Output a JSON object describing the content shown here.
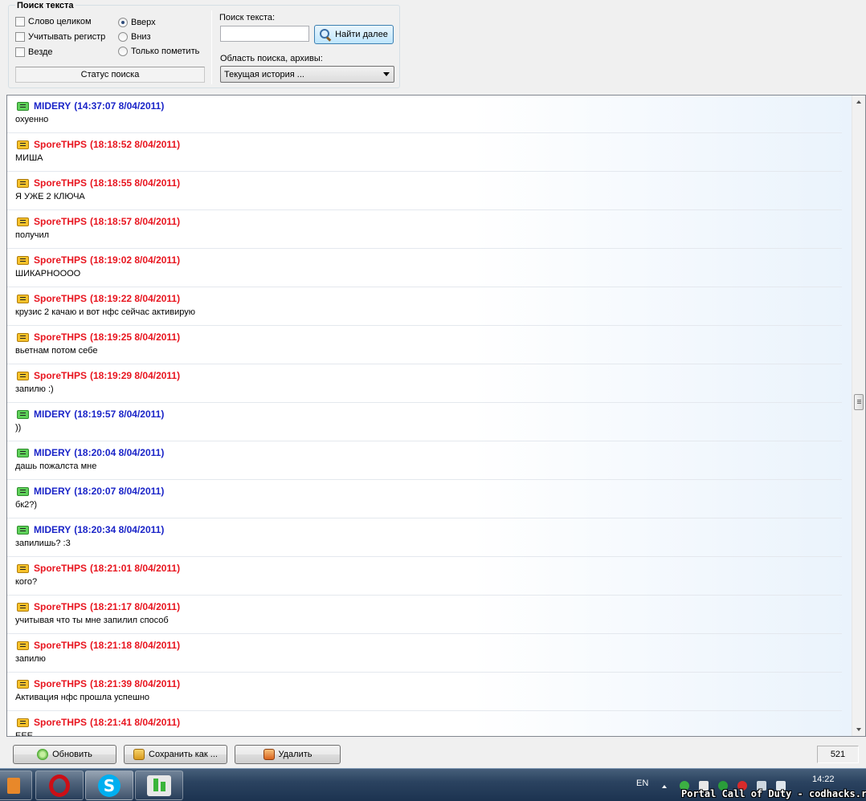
{
  "search": {
    "group_title": "Поиск текста",
    "options": {
      "whole_word": "Слово целиком",
      "match_case": "Учитывать регистр",
      "everywhere": "Везде",
      "up": "Вверх",
      "down": "Вниз",
      "mark_only": "Только пометить"
    },
    "direction_selected": "up",
    "status_label": "Статус поиска",
    "text_label": "Поиск текста:",
    "text_value": "",
    "find_next_label": "Найти далее",
    "scope_label": "Область поиска, архивы:",
    "scope_value": "Текущая история ..."
  },
  "messages": [
    {
      "sender": "MIDERY",
      "time": "(14:37:07 8/04/2011)",
      "text": "охуенно",
      "color": "#1a24c8"
    },
    {
      "sender": "SporeTHPS",
      "time": "(18:18:52 8/04/2011)",
      "text": "МИША",
      "color": "#e8151f"
    },
    {
      "sender": "SporeTHPS",
      "time": "(18:18:55 8/04/2011)",
      "text": "Я УЖЕ 2 КЛЮЧА",
      "color": "#e8151f"
    },
    {
      "sender": "SporeTHPS",
      "time": "(18:18:57 8/04/2011)",
      "text": "получил",
      "color": "#e8151f"
    },
    {
      "sender": "SporeTHPS",
      "time": "(18:19:02 8/04/2011)",
      "text": "ШИКАРНОООО",
      "color": "#e8151f"
    },
    {
      "sender": "SporeTHPS",
      "time": "(18:19:22 8/04/2011)",
      "text": "крузис 2 качаю и вот нфс сейчас активирую",
      "color": "#e8151f"
    },
    {
      "sender": "SporeTHPS",
      "time": "(18:19:25 8/04/2011)",
      "text": "вьетнам потом себе",
      "color": "#e8151f"
    },
    {
      "sender": "SporeTHPS",
      "time": "(18:19:29 8/04/2011)",
      "text": "запилю :)",
      "color": "#e8151f"
    },
    {
      "sender": "MIDERY",
      "time": "(18:19:57 8/04/2011)",
      "text": "))",
      "color": "#1a24c8"
    },
    {
      "sender": "MIDERY",
      "time": "(18:20:04 8/04/2011)",
      "text": "дашь пожалста мне",
      "color": "#1a24c8"
    },
    {
      "sender": "MIDERY",
      "time": "(18:20:07 8/04/2011)",
      "text": "бк2?)",
      "color": "#1a24c8"
    },
    {
      "sender": "MIDERY",
      "time": "(18:20:34 8/04/2011)",
      "text": "запилишь? :3",
      "color": "#1a24c8"
    },
    {
      "sender": "SporeTHPS",
      "time": "(18:21:01 8/04/2011)",
      "text": "кого?",
      "color": "#e8151f"
    },
    {
      "sender": "SporeTHPS",
      "time": "(18:21:17 8/04/2011)",
      "text": "учитывая что ты мне запилил способ",
      "color": "#e8151f"
    },
    {
      "sender": "SporeTHPS",
      "time": "(18:21:18 8/04/2011)",
      "text": "запилю",
      "color": "#e8151f"
    },
    {
      "sender": "SporeTHPS",
      "time": "(18:21:39 8/04/2011)",
      "text": "Активация нфс прошла успешно",
      "color": "#e8151f"
    },
    {
      "sender": "SporeTHPS",
      "time": "(18:21:41 8/04/2011)",
      "text": "ЕЕЕ",
      "color": "#e8151f"
    }
  ],
  "toolbar": {
    "refresh_label": "Обновить",
    "save_label": "Сохранить как ...",
    "delete_label": "Удалить",
    "count": "521"
  },
  "taskbar": {
    "language": "EN",
    "clock": "14:22",
    "apps": [
      "opera-icon",
      "skype-icon",
      "qip-icon"
    ]
  },
  "watermark": "Portal Call of Duty - codhacks.ru"
}
